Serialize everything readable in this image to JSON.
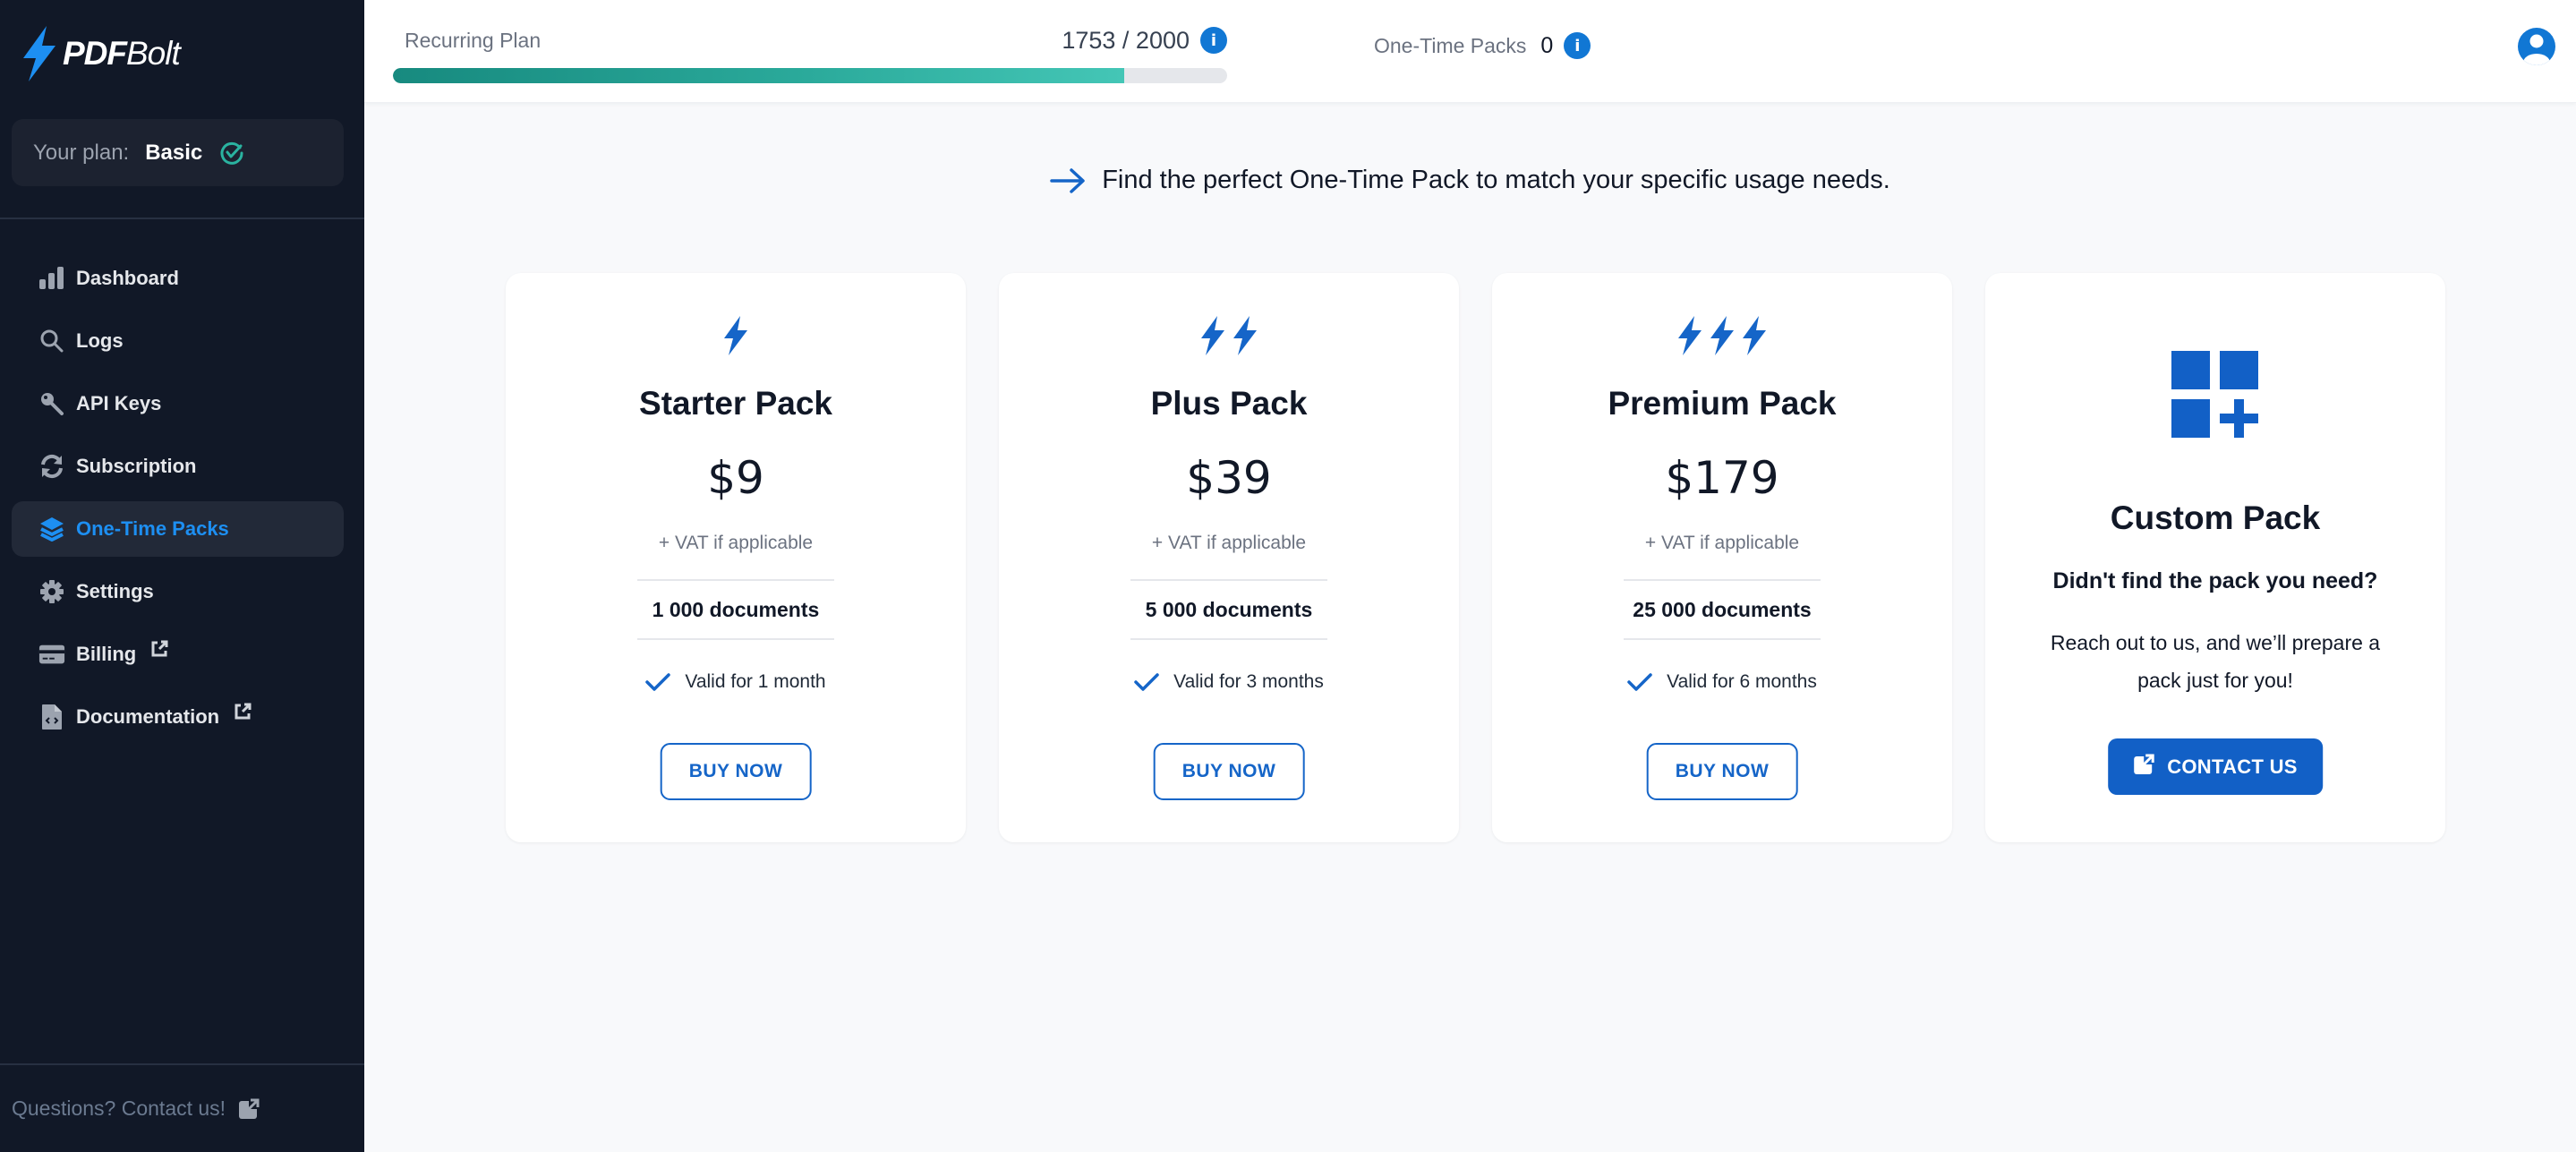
{
  "app": {
    "logo_bold": "PDF",
    "logo_regular": "Bolt",
    "brand_color": "#1d8ff2"
  },
  "sidebar": {
    "plan_label": "Your plan:",
    "plan_value": "Basic",
    "items": [
      {
        "label": "Dashboard",
        "icon": "bar-chart-icon",
        "active": false,
        "external": false
      },
      {
        "label": "Logs",
        "icon": "search-icon",
        "active": false,
        "external": false
      },
      {
        "label": "API Keys",
        "icon": "key-icon",
        "active": false,
        "external": false
      },
      {
        "label": "Subscription",
        "icon": "refresh-icon",
        "active": false,
        "external": false
      },
      {
        "label": "One-Time Packs",
        "icon": "layers-icon",
        "active": true,
        "external": false
      },
      {
        "label": "Settings",
        "icon": "gear-icon",
        "active": false,
        "external": false
      },
      {
        "label": "Billing",
        "icon": "credit-card-icon",
        "active": false,
        "external": true
      },
      {
        "label": "Documentation",
        "icon": "code-file-icon",
        "active": false,
        "external": true
      }
    ],
    "footer_contact": "Questions? Contact us!"
  },
  "header": {
    "recurring_label": "Recurring Plan",
    "recurring_used": 1753,
    "recurring_total": 2000,
    "recurring_text": "1753 / 2000",
    "recurring_fraction": 0.8765,
    "onetime_label": "One-Time Packs",
    "onetime_value": "0"
  },
  "main": {
    "intro": "Find the perfect One-Time Pack to match your specific usage needs.",
    "packs": [
      {
        "title": "Starter Pack",
        "bolts": 1,
        "price": "$9",
        "vat": "+ VAT if applicable",
        "documents": "1 000 documents",
        "validity": "Valid for 1 month",
        "button": "BUY NOW"
      },
      {
        "title": "Plus Pack",
        "bolts": 2,
        "price": "$39",
        "vat": "+ VAT if applicable",
        "documents": "5 000 documents",
        "validity": "Valid for 3 months",
        "button": "BUY NOW"
      },
      {
        "title": "Premium Pack",
        "bolts": 3,
        "price": "$179",
        "vat": "+ VAT if applicable",
        "documents": "25 000 documents",
        "validity": "Valid for 6 months",
        "button": "BUY NOW"
      }
    ],
    "custom": {
      "title": "Custom Pack",
      "subtitle": "Didn't find the pack you need?",
      "description": "Reach out to us, and we’ll prepare a pack just for you!",
      "button": "CONTACT US"
    }
  },
  "colors": {
    "accent": "#1565c8",
    "progress_start": "#178a7f",
    "progress_end": "#44c6b6",
    "info": "#1177d4",
    "check_teal": "#2ab3a0"
  }
}
